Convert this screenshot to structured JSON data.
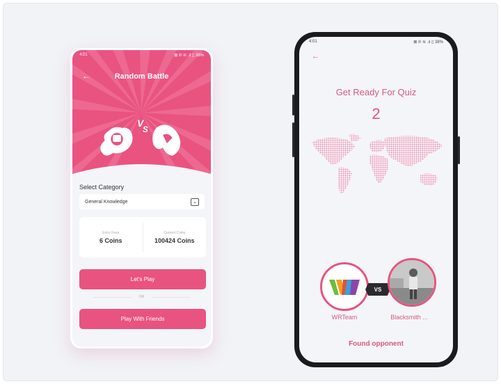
{
  "left_screen": {
    "status_time": "4:01",
    "status_icons": "⊠ ℗ ≋ .ıl ▯ 38%",
    "title": "Random Battle",
    "versus_text": "VS",
    "section_label": "Select Category",
    "category_selected": "General Knowledge",
    "chevron": "⌄",
    "entry_fees_label": "Entry Fees",
    "entry_fees_value": "6 Coins",
    "current_coins_label": "Current Coins",
    "current_coins_value": "100424 Coins",
    "play_button": "Let's Play",
    "or_text": "OR",
    "friends_button": "Play With Friends"
  },
  "right_screen": {
    "status_time": "4:01",
    "status_icons": "⊠ ℗ ≋ .ıl ▯ 38%",
    "title": "Get Ready For Quiz",
    "countdown": "2",
    "vs_label": "VS",
    "player_one": "WRTeam",
    "player_two": "Blacksmith ...",
    "status_message": "Found opponent"
  },
  "colors": {
    "accent": "#e9537f",
    "accent_dark": "#d8587e",
    "background": "#f1f3f6"
  },
  "icons": [
    "back-arrow-icon",
    "flame-fist-icon",
    "flame-hand-icon",
    "chevron-down-icon",
    "world-map"
  ]
}
